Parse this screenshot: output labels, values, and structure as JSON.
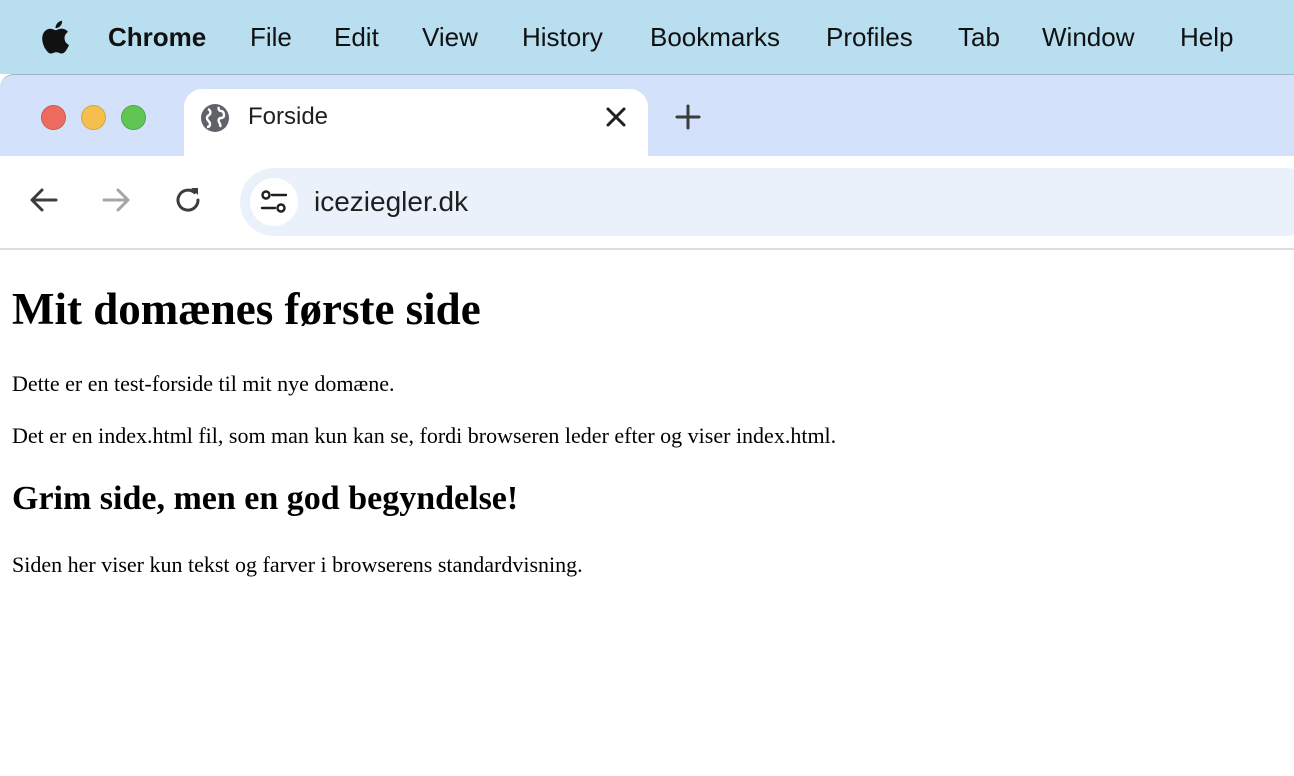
{
  "menubar": {
    "app_name": "Chrome",
    "items": [
      "File",
      "Edit",
      "View",
      "History",
      "Bookmarks",
      "Profiles",
      "Tab",
      "Window",
      "Help"
    ],
    "background_color": "#b8def0"
  },
  "tabs": {
    "active_title": "Forside",
    "icons": {
      "favicon": "globe-icon",
      "close": "close-icon",
      "new_tab": "plus-icon"
    },
    "strip_color": "#d4e1fa"
  },
  "toolbar": {
    "url": "iceziegler.dk",
    "icons": {
      "back": "arrow-left-icon",
      "forward": "arrow-right-icon",
      "reload": "reload-icon",
      "site_info": "tune-icon"
    }
  },
  "page": {
    "heading": "Mit domænes første side",
    "paragraph1": "Dette er en test-forside til mit nye domæne.",
    "paragraph2": "Det er en index.html fil, som man kun kan se, fordi browseren leder efter og viser index.html.",
    "subheading": "Grim side, men en god begyndelse!",
    "paragraph3": "Siden her viser kun tekst og farver i browserens standardvisning."
  }
}
